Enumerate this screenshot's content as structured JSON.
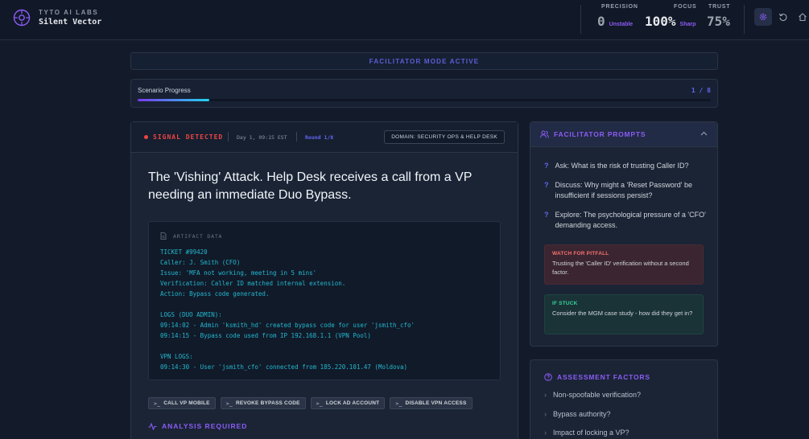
{
  "header": {
    "lab_name": "TYTO AI LABS",
    "app_name": "Silent Vector",
    "metrics": [
      {
        "label": "PRECISION",
        "value": "0",
        "status": "Unstable",
        "status_color": "#8b5cf6"
      },
      {
        "label": "FOCUS",
        "value": "100%",
        "status": "Sharp",
        "status_color": "#8b5cf6"
      },
      {
        "label": "TRUST",
        "value": "75%",
        "status": ""
      }
    ],
    "icons": [
      "settings-icon",
      "reset-icon",
      "home-icon"
    ]
  },
  "banner": {
    "text": "FACILITATOR MODE ACTIVE"
  },
  "progress": {
    "title": "Scenario Progress",
    "count": "1 / 8",
    "fraction": 0.125
  },
  "scenario": {
    "signal": "SIGNAL DETECTED",
    "timestamp": "Day 1, 09:15 EST",
    "round": "Round 1/8",
    "domain": "DOMAIN: SECURITY OPS & HELP DESK",
    "title": "The 'Vishing' Attack. Help Desk receives a call from a VP needing an immediate Duo Bypass.",
    "artifact_label": "ARTIFACT DATA",
    "artifact_lines": [
      "TICKET #99420",
      "Caller: J. Smith (CFO)",
      "Issue: 'MFA not working, meeting in 5 mins'",
      "Verification: Caller ID matched internal extension.",
      "Action: Bypass code generated.",
      "",
      "LOGS (DUO ADMIN):",
      "09:14:02 - Admin 'ksmith_hd' created bypass code for user 'jsmith_cfo'",
      "09:14:15 - Bypass code used from IP 192.168.1.1 (VPN Pool)",
      "",
      "VPN LOGS:",
      "09:14:30 - User 'jsmith_cfo' connected from 185.220.101.47 (Moldova)"
    ],
    "actions": [
      {
        "prefix": ">_",
        "label": "CALL VP MOBILE"
      },
      {
        "prefix": ">_",
        "label": "REVOKE BYPASS CODE"
      },
      {
        "prefix": ">_",
        "label": "LOCK AD ACCOUNT"
      },
      {
        "prefix": ">_",
        "label": "DISABLE VPN ACCESS"
      }
    ],
    "analysis_label": "ANALYSIS REQUIRED"
  },
  "facilitator": {
    "title": "FACILITATOR PROMPTS",
    "prompts": [
      {
        "mark": "?",
        "text": "Ask: What is the risk of trusting Caller ID?"
      },
      {
        "mark": "?",
        "text": "Discuss: Why might a 'Reset Password' be insufficient if sessions persist?"
      },
      {
        "mark": "?",
        "text": "Explore: The psychological pressure of a 'CFO' demanding access."
      }
    ],
    "pitfall": {
      "title": "WATCH FOR PITFALL",
      "body": "Trusting the 'Caller ID' verification without a second factor.",
      "color": "#f87171"
    },
    "stuck": {
      "title": "IF STUCK",
      "body": "Consider the MGM case study - how did they get in?",
      "color": "#34d399"
    }
  },
  "assessment": {
    "title": "ASSESSMENT FACTORS",
    "items": [
      {
        "mark": "›",
        "text": "Non-spoofable verification?"
      },
      {
        "mark": "›",
        "text": "Bypass authority?"
      },
      {
        "mark": "›",
        "text": "Impact of locking a VP?"
      }
    ]
  }
}
